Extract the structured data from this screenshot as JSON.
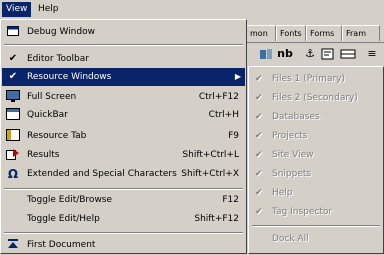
{
  "menubar": {
    "view": "View",
    "help": "Help"
  },
  "tabs": [
    "mon",
    "Fonts",
    "Forms",
    "Fram"
  ],
  "toolbar": {
    "nb": "nb"
  },
  "view_menu": {
    "items": [
      {
        "label": "Debug Window",
        "shortcut": "",
        "icon": "debug-window-icon"
      },
      {
        "label": "Editor Toolbar",
        "shortcut": "",
        "icon": "check-icon"
      },
      {
        "label": "Resource Windows",
        "shortcut": "",
        "icon": "check-icon"
      },
      {
        "label": "Full Screen",
        "shortcut": "Ctrl+F12",
        "icon": "full-screen-icon"
      },
      {
        "label": "QuickBar",
        "shortcut": "Ctrl+H",
        "icon": "quickbar-icon"
      },
      {
        "label": "Resource Tab",
        "shortcut": "F9",
        "icon": "resource-tab-icon"
      },
      {
        "label": "Results",
        "shortcut": "Shift+Ctrl+L",
        "icon": "results-icon"
      },
      {
        "label": "Extended and Special Characters",
        "shortcut": "Shift+Ctrl+X",
        "icon": "omega-icon"
      },
      {
        "label": "Toggle Edit/Browse",
        "shortcut": "F12",
        "icon": ""
      },
      {
        "label": "Toggle Edit/Help",
        "shortcut": "Shift+F12",
        "icon": ""
      },
      {
        "label": "First Document",
        "shortcut": "",
        "icon": "first-document-icon"
      }
    ]
  },
  "resource_submenu": {
    "items": [
      "Files 1 (Primary)",
      "Files 2 (Secondary)",
      "Databases",
      "Projects",
      "Site View",
      "Snippets",
      "Help",
      "Tag Inspector",
      "Dock All"
    ]
  }
}
